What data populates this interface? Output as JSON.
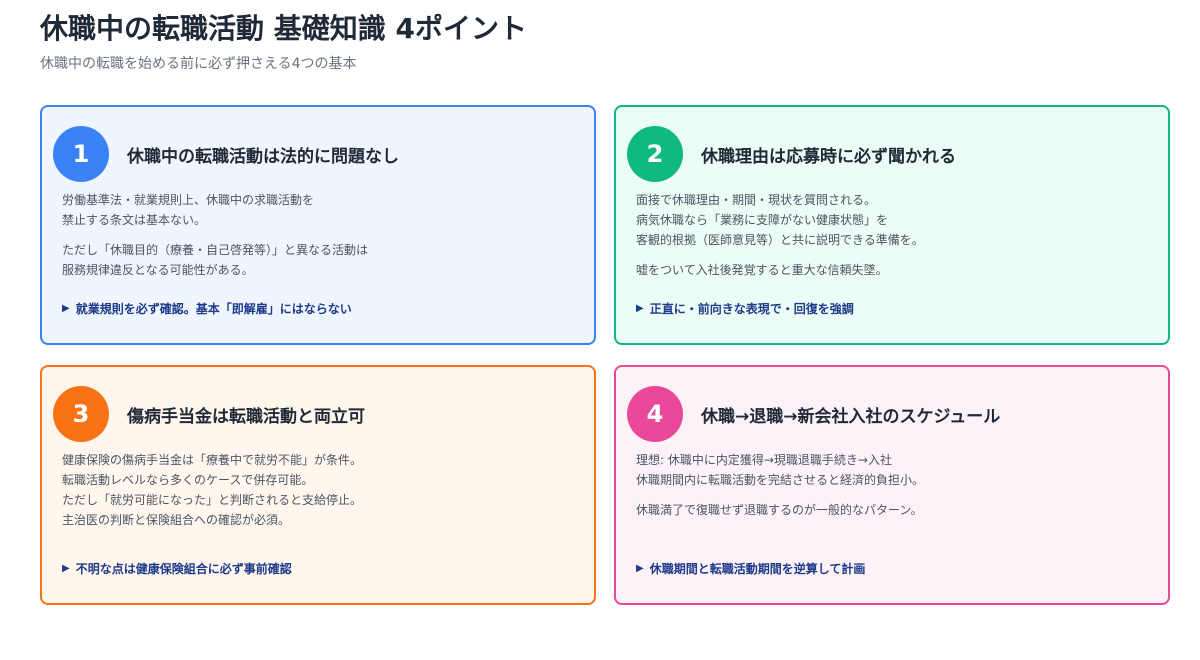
{
  "header": {
    "title": "休職中の転職活動 基礎知識 4ポイント",
    "subtitle": "休職中の転職を始める前に必ず押さえる4つの基本"
  },
  "cards": [
    {
      "number": "1",
      "title": "休職中の転職活動は法的に問題なし",
      "paragraphs": [
        "労働基準法・就業規則上、休職中の求職活動を\n禁止する条文は基本ない。",
        "ただし「休職目的（療養・自己啓発等）」と異なる活動は\n服務規律違反となる可能性がある。"
      ],
      "note": "就業規則を必ず確認。基本「即解雇」にはならない",
      "note_icon": "triangle-right-icon",
      "color": "#3b82f6",
      "bg": "#eff6ff"
    },
    {
      "number": "2",
      "title": "休職理由は応募時に必ず聞かれる",
      "paragraphs": [
        "面接で休職理由・期間・現状を質問される。\n病気休職なら「業務に支障がない健康状態」を\n客観的根拠（医師意見等）と共に説明できる準備を。",
        "嘘をついて入社後発覚すると重大な信頼失墜。"
      ],
      "note": "正直に・前向きな表現で・回復を強調",
      "note_icon": "triangle-right-icon",
      "color": "#10b981",
      "bg": "#ecfdf5"
    },
    {
      "number": "3",
      "title": "傷病手当金は転職活動と両立可",
      "paragraphs": [
        "健康保険の傷病手当金は「療養中で就労不能」が条件。\n転職活動レベルなら多くのケースで併存可能。\nただし「就労可能になった」と判断されると支給停止。\n主治医の判断と保険組合への確認が必須。"
      ],
      "note": "不明な点は健康保険組合に必ず事前確認",
      "note_icon": "triangle-right-icon",
      "color": "#f97316",
      "bg": "#fff7ed"
    },
    {
      "number": "4",
      "title": "休職→退職→新会社入社のスケジュール",
      "paragraphs": [
        "理想: 休職中に内定獲得→現職退職手続き→入社\n休職期間内に転職活動を完結させると経済的負担小。",
        "休職満了で復職せず退職するのが一般的なパターン。"
      ],
      "note": "休職期間と転職活動期間を逆算して計画",
      "note_icon": "triangle-right-icon",
      "color": "#ec4899",
      "bg": "#fdf2f8"
    }
  ]
}
